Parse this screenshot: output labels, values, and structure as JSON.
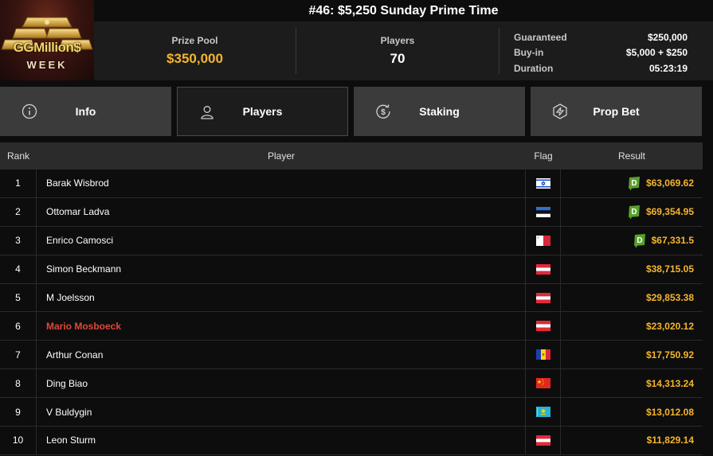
{
  "header": {
    "logo_text": "GGMillion$",
    "logo_sub": "WEEK",
    "title": "#46: $5,250 Sunday Prime Time",
    "prize_pool_label": "Prize Pool",
    "prize_pool_value": "$350,000",
    "players_label": "Players",
    "players_value": "70",
    "guaranteed_label": "Guaranteed",
    "guaranteed_value": "$250,000",
    "buyin_label": "Buy-in",
    "buyin_value": "$5,000 + $250",
    "duration_label": "Duration",
    "duration_value": "05:23:19"
  },
  "tabs": [
    {
      "label": "Info",
      "icon": "info-icon"
    },
    {
      "label": "Players",
      "icon": "user-icon",
      "active": true
    },
    {
      "label": "Staking",
      "icon": "staking-icon"
    },
    {
      "label": "Prop Bet",
      "icon": "prop-bet-icon"
    }
  ],
  "table": {
    "columns": [
      "Rank",
      "Player",
      "Flag",
      "Result"
    ],
    "rows": [
      {
        "rank": "1",
        "player": "Barak Wisbrod",
        "flag": "israel",
        "result": "$63,069.62",
        "deal": true
      },
      {
        "rank": "2",
        "player": "Ottomar Ladva",
        "flag": "estonia",
        "result": "$69,354.95",
        "deal": true
      },
      {
        "rank": "3",
        "player": "Enrico Camosci",
        "flag": "malta",
        "result": "$67,331.5",
        "deal": true
      },
      {
        "rank": "4",
        "player": "Simon Beckmann",
        "flag": "austria",
        "result": "$38,715.05"
      },
      {
        "rank": "5",
        "player": "M Joelsson",
        "flag": "austria",
        "result": "$29,853.38"
      },
      {
        "rank": "6",
        "player": "Mario Mosboeck",
        "flag": "austria",
        "result": "$23,020.12",
        "highlight": true
      },
      {
        "rank": "7",
        "player": "Arthur Conan",
        "flag": "andorra",
        "result": "$17,750.92"
      },
      {
        "rank": "8",
        "player": "Ding Biao",
        "flag": "china",
        "result": "$14,313.24"
      },
      {
        "rank": "9",
        "player": "V Buldygin",
        "flag": "kazakhstan",
        "result": "$13,012.08"
      },
      {
        "rank": "10",
        "player": "Leon Sturm",
        "flag": "austria",
        "result": "$11,829.14"
      }
    ],
    "deal_badge_letter": "D"
  },
  "colors": {
    "accent_gold": "#f5b52c",
    "highlight_red": "#e0473a",
    "deal_green": "#5aa02c"
  }
}
